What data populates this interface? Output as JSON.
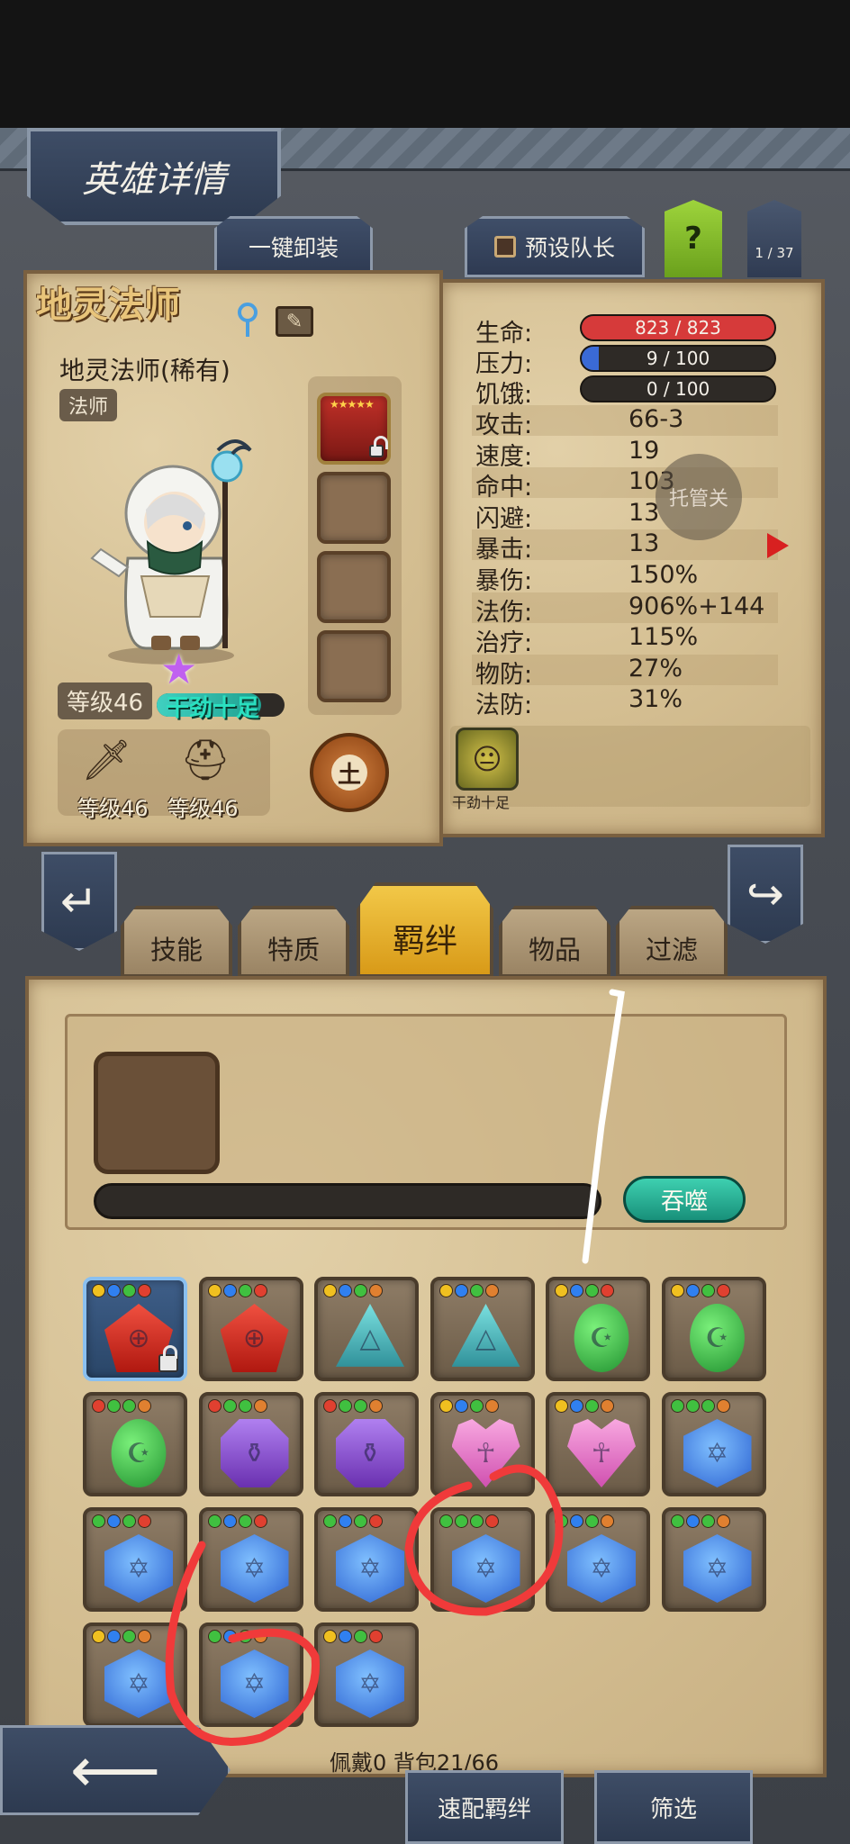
{
  "header": {
    "title": "英雄详情",
    "unequip_all_label": "一键卸装",
    "preset_leader_label": "预设队长",
    "help_label": "?",
    "page_indicator": "1 / 37"
  },
  "hero": {
    "name": "地灵法师",
    "subtitle": "地灵法师(稀有)",
    "class": "法师",
    "level": "等级46",
    "trait": "干劲十足",
    "element": "土",
    "equipment": [
      {
        "label": "等级46",
        "icon": "sword-icon"
      },
      {
        "label": "等级46",
        "icon": "helmet-icon"
      }
    ],
    "equip_slot_stars": "★★★★★"
  },
  "stats": {
    "bars": [
      {
        "label": "生命:",
        "value": "823 / 823",
        "fill": 1.0,
        "color": "#d63a3a"
      },
      {
        "label": "压力:",
        "value": "9 / 100",
        "fill": 0.09,
        "color": "#3a6ad6"
      },
      {
        "label": "饥饿:",
        "value": "0 / 100",
        "fill": 0.0,
        "color": "#6a6a6a"
      }
    ],
    "rows": [
      {
        "label": "攻击:",
        "value": "66-3"
      },
      {
        "label": "速度:",
        "value": "19"
      },
      {
        "label": "命中:",
        "value": "103"
      },
      {
        "label": "闪避:",
        "value": "13"
      },
      {
        "label": "暴击:",
        "value": "13"
      },
      {
        "label": "暴伤:",
        "value": "150%"
      },
      {
        "label": "法伤:",
        "value": "906%+144"
      },
      {
        "label": "治疗:",
        "value": "115%"
      },
      {
        "label": "物防:",
        "value": "27%"
      },
      {
        "label": "法防:",
        "value": "31%"
      }
    ],
    "float_button": "托管关",
    "skill_label": "干劲十足"
  },
  "tabs": [
    {
      "label": "技能",
      "active": false
    },
    {
      "label": "特质",
      "active": false
    },
    {
      "label": "羁绊",
      "active": true
    },
    {
      "label": "物品",
      "active": false
    },
    {
      "label": "过滤",
      "active": false
    }
  ],
  "bond_panel": {
    "devour_label": "吞噬",
    "count_text": "佩戴0 背包21/66",
    "quick_bond_label": "速配羁绊",
    "filter_label": "筛选"
  },
  "gems": [
    {
      "shape": "pentagon",
      "dots": [
        "#f0c020",
        "#3080f0",
        "#40c040",
        "#e04030"
      ],
      "locked": true,
      "selected": true
    },
    {
      "shape": "pentagon",
      "dots": [
        "#f0c020",
        "#3080f0",
        "#40c040",
        "#e04030"
      ],
      "locked": false,
      "selected": false
    },
    {
      "shape": "triangle",
      "dots": [
        "#f0c020",
        "#3080f0",
        "#40c040",
        "#e08030"
      ],
      "locked": false,
      "selected": false
    },
    {
      "shape": "triangle",
      "dots": [
        "#f0c020",
        "#3080f0",
        "#40c040",
        "#e08030"
      ],
      "locked": false,
      "selected": false
    },
    {
      "shape": "oval",
      "dots": [
        "#f0c020",
        "#3080f0",
        "#40c040",
        "#e04030"
      ],
      "locked": false,
      "selected": false
    },
    {
      "shape": "oval",
      "dots": [
        "#f0c020",
        "#3080f0",
        "#40c040",
        "#e04030"
      ],
      "locked": false,
      "selected": false
    },
    {
      "shape": "oval",
      "dots": [
        "#e04030",
        "#40c040",
        "#40c040",
        "#e08030"
      ],
      "locked": false,
      "selected": false
    },
    {
      "shape": "octagon",
      "dots": [
        "#e04030",
        "#40c040",
        "#40c040",
        "#e08030"
      ],
      "locked": false,
      "selected": false
    },
    {
      "shape": "octagon",
      "dots": [
        "#e04030",
        "#40c040",
        "#40c040",
        "#e08030"
      ],
      "locked": false,
      "selected": false
    },
    {
      "shape": "heart",
      "dots": [
        "#f0c020",
        "#3080f0",
        "#40c040",
        "#e08030"
      ],
      "locked": false,
      "selected": false
    },
    {
      "shape": "heart",
      "dots": [
        "#f0c020",
        "#3080f0",
        "#40c040",
        "#e08030"
      ],
      "locked": false,
      "selected": false
    },
    {
      "shape": "hexagon",
      "dots": [
        "#40c040",
        "#40c040",
        "#40c040",
        "#e08030"
      ],
      "locked": false,
      "selected": false
    },
    {
      "shape": "hexagon",
      "dots": [
        "#40c040",
        "#3080f0",
        "#40c040",
        "#e04030"
      ],
      "locked": false,
      "selected": false
    },
    {
      "shape": "hexagon",
      "dots": [
        "#40c040",
        "#3080f0",
        "#40c040",
        "#e04030"
      ],
      "locked": false,
      "selected": false
    },
    {
      "shape": "hexagon",
      "dots": [
        "#40c040",
        "#3080f0",
        "#40c040",
        "#e04030"
      ],
      "locked": false,
      "selected": false
    },
    {
      "shape": "hexagon",
      "dots": [
        "#40c040",
        "#40c040",
        "#40c040",
        "#e04030"
      ],
      "locked": false,
      "selected": false
    },
    {
      "shape": "hexagon",
      "dots": [
        "#40c040",
        "#3080f0",
        "#40c040",
        "#e08030"
      ],
      "locked": false,
      "selected": false
    },
    {
      "shape": "hexagon",
      "dots": [
        "#40c040",
        "#3080f0",
        "#40c040",
        "#e08030"
      ],
      "locked": false,
      "selected": false
    },
    {
      "shape": "hexagon",
      "dots": [
        "#f0c020",
        "#3080f0",
        "#40c040",
        "#e08030"
      ],
      "locked": false,
      "selected": false
    },
    {
      "shape": "hexagon",
      "dots": [
        "#40c040",
        "#3080f0",
        "#40c040",
        "#e08030"
      ],
      "locked": false,
      "selected": false
    },
    {
      "shape": "hexagon",
      "dots": [
        "#f0c020",
        "#3080f0",
        "#40c040",
        "#e04030"
      ],
      "locked": false,
      "selected": false
    }
  ],
  "colors": {
    "parchment": "#d8c49a",
    "active_tab": "#f2c848",
    "devour_button": "#3ed0b0",
    "annotation_red": "#f03a3a"
  }
}
